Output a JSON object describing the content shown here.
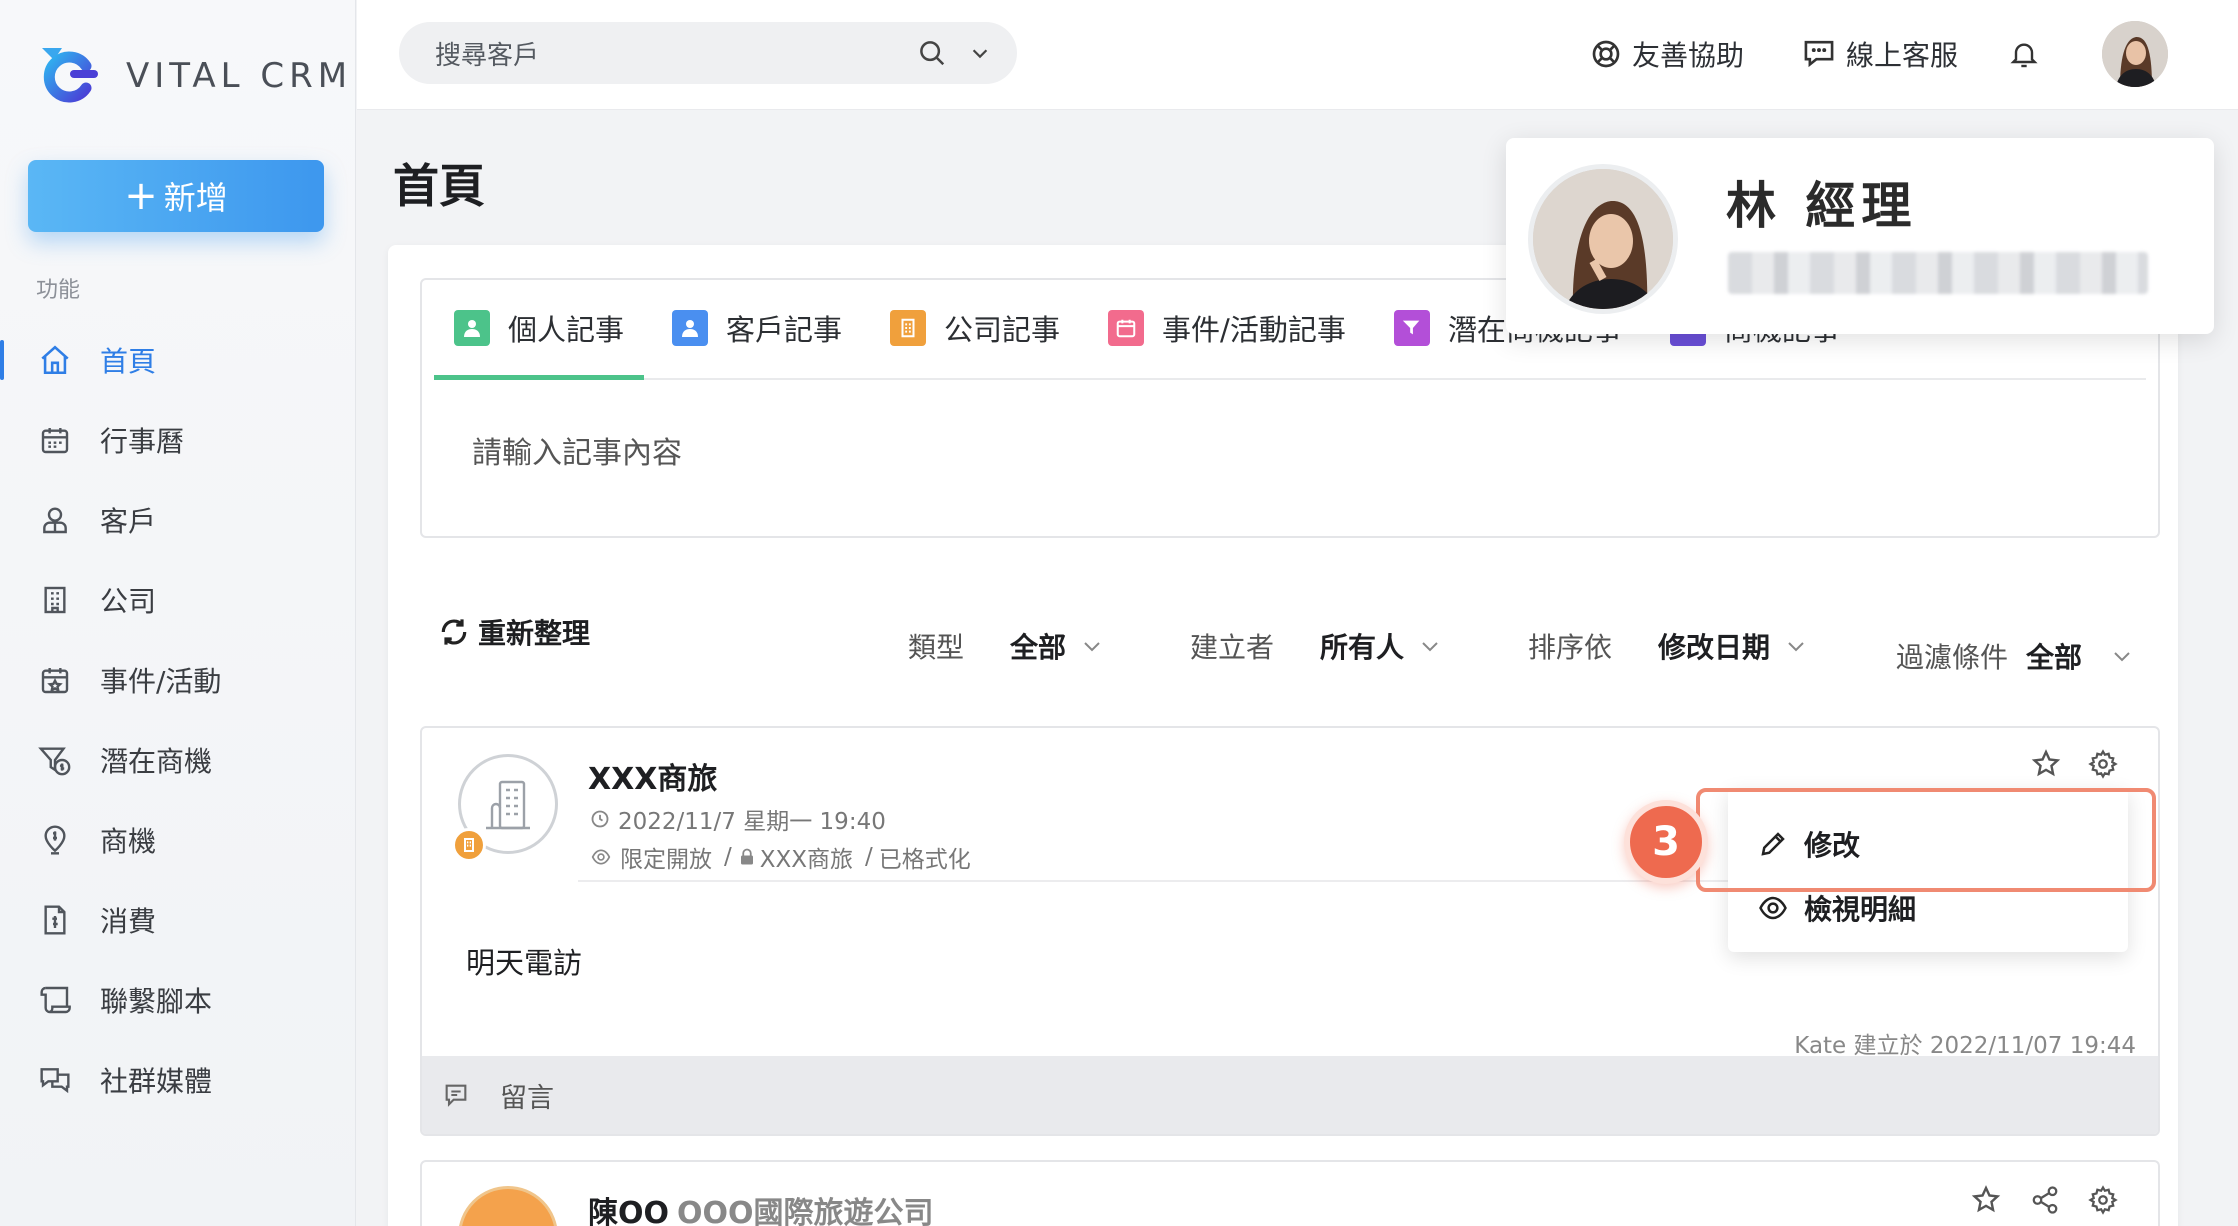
{
  "app": {
    "logo_text": "VITAL CRM",
    "accent": "#2f7ee6"
  },
  "sidebar": {
    "new_label": "新增",
    "section_label": "功能",
    "items": [
      {
        "label": "首頁",
        "icon": "home-icon",
        "active": true
      },
      {
        "label": "行事曆",
        "icon": "calendar-icon"
      },
      {
        "label": "客戶",
        "icon": "customer-icon"
      },
      {
        "label": "公司",
        "icon": "building-icon"
      },
      {
        "label": "事件/活動",
        "icon": "event-icon"
      },
      {
        "label": "潛在商機",
        "icon": "funnel-icon"
      },
      {
        "label": "商機",
        "icon": "opportunity-icon"
      },
      {
        "label": "消費",
        "icon": "receipt-icon"
      },
      {
        "label": "聯繫腳本",
        "icon": "script-icon"
      },
      {
        "label": "社群媒體",
        "icon": "chat-icon"
      }
    ]
  },
  "topbar": {
    "search_placeholder": "搜尋客戶",
    "help_label": "友善協助",
    "support_label": "線上客服"
  },
  "page": {
    "title": "首頁"
  },
  "note": {
    "tabs": [
      {
        "label": "個人記事",
        "color": "#4cc38a",
        "active": true
      },
      {
        "label": "客戶記事",
        "color": "#4a8ff0"
      },
      {
        "label": "公司記事",
        "color": "#f0a03c"
      },
      {
        "label": "事件/活動記事",
        "color": "#f26b8d"
      },
      {
        "label": "潛在商機記事",
        "color": "#b34fd8"
      },
      {
        "label": "商機記事",
        "color": "#6a4fd8"
      }
    ],
    "placeholder": "請輸入記事內容"
  },
  "filters": {
    "refresh_label": "重新整理",
    "type_label": "類型",
    "type_value": "全部",
    "creator_label": "建立者",
    "creator_value": "所有人",
    "sort_label": "排序依",
    "sort_value": "修改日期",
    "filter_label": "過濾條件",
    "filter_value": "全部"
  },
  "record": {
    "title": "XXX商旅",
    "datetime": "2022/11/7 星期一 19:40",
    "visibility": "限定開放",
    "linked": "XXX商旅",
    "status": "已格式化",
    "body": "明天電訪",
    "created": "Kate 建立於 2022/11/07 19:44",
    "comment_label": "留言"
  },
  "dropdown": {
    "edit_label": "修改",
    "view_label": "檢視明細"
  },
  "step": {
    "number": "3"
  },
  "record2": {
    "title": "陳OO",
    "company": "OOO國際旅遊公司"
  },
  "profile": {
    "name": "林 經理"
  }
}
